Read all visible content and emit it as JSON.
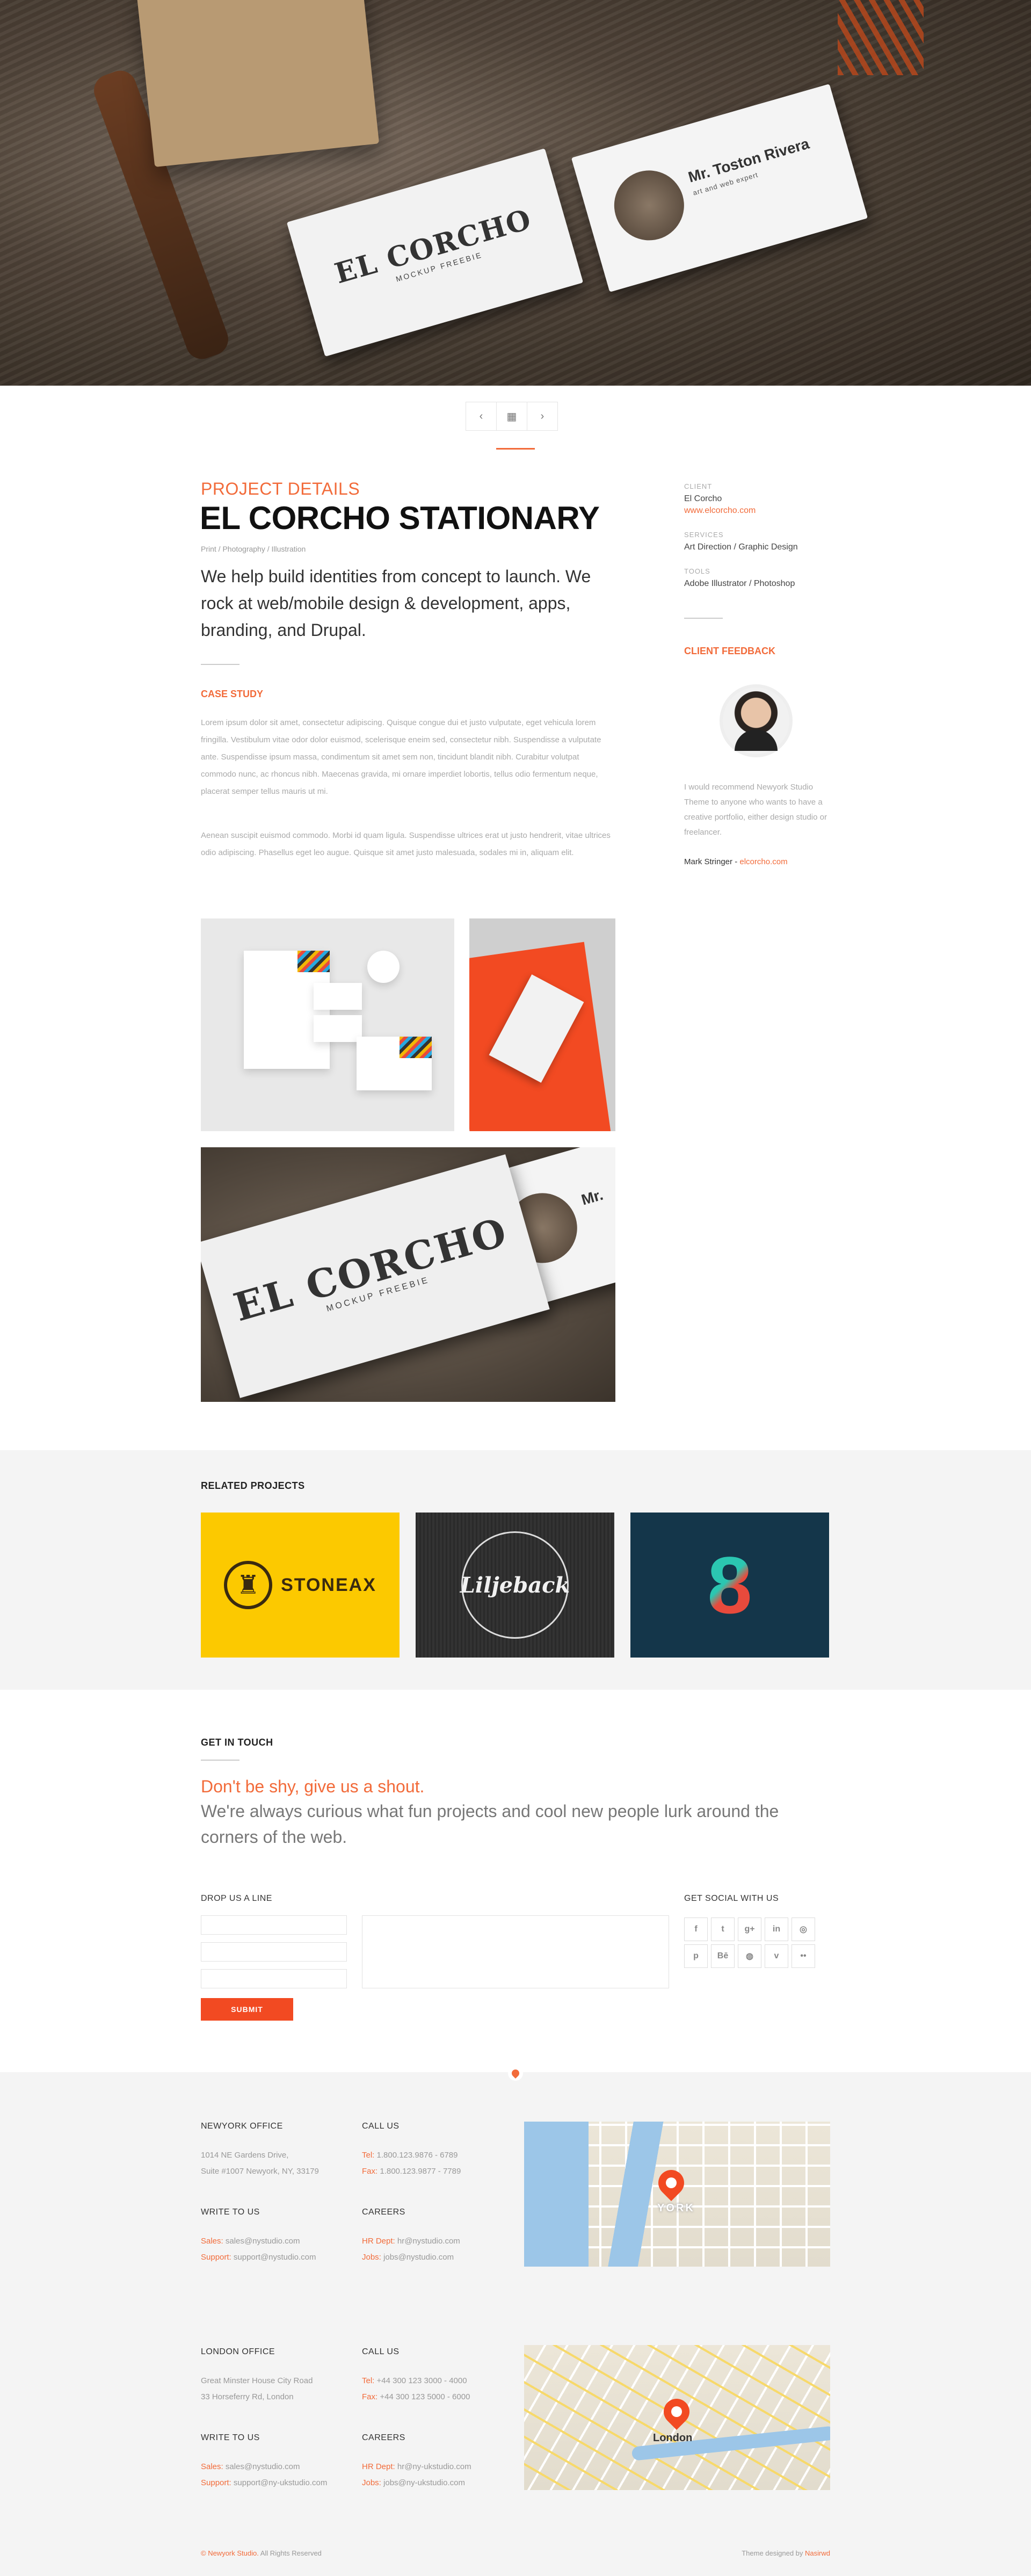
{
  "hero": {
    "card_logo": "EL CORCHO",
    "card_sub": "MOCKUP FREEBIE",
    "card2_name": "Mr. Toston Rivera",
    "card2_title": "art and web expert"
  },
  "postnav": {
    "prev_icon": "‹",
    "grid_icon": "▦",
    "next_icon": "›"
  },
  "project": {
    "kicker": "PROJECT DETAILS",
    "title": "EL CORCHO STATIONARY",
    "categories": "Print / Photography / Illustration",
    "lead": "We help build identities from concept to launch. We rock at web/mobile design & development, apps, branding, and Drupal.",
    "case_title": "CASE STUDY",
    "case_p1": "Lorem ipsum dolor sit amet, consectetur adipiscing. Quisque congue dui et justo vulputate, eget vehicula lorem fringilla. Vestibulum vitae odor dolor euismod, scelerisque eneim sed, consectetur nibh. Suspendisse a vulputate ante. Suspendisse ipsum massa, condimentum sit amet sem non, tincidunt blandit nibh. Curabitur volutpat commodo nunc, ac rhoncus nibh. Maecenas gravida, mi ornare imperdiet lobortis, tellus odio fermentum neque, placerat semper tellus mauris ut mi.",
    "case_p2": "Aenean suscipit euismod commodo. Morbi id quam ligula. Suspendisse ultrices erat ut justo hendrerit, vitae ultrices odio adipiscing. Phasellus eget leo augue. Quisque sit amet justo malesuada, sodales mi in, aliquam elit."
  },
  "meta": {
    "client_label": "CLIENT",
    "client_name": "El Corcho",
    "client_url": "www.elcorcho.com",
    "services_label": "SERVICES",
    "services": "Art Direction / Graphic Design",
    "tools_label": "TOOLS",
    "tools": "Adobe Illustrator / Photoshop"
  },
  "feedback": {
    "title": "CLIENT FEEDBACK",
    "quote": "I would recommend Newyork Studio Theme to anyone who wants to have a creative portfolio, either design studio or freelancer.",
    "author": "Mark Stringer",
    "author_site": "elcorcho.com"
  },
  "gallery": {
    "g3_logo": "EL CORCHO",
    "g3_sub": "MOCKUP FREEBIE",
    "g3_name": "Mr."
  },
  "related": {
    "title": "RELATED PROJECTS",
    "items": [
      {
        "label": "STONEAX"
      },
      {
        "label": "Liljeback"
      },
      {
        "label": "8"
      }
    ]
  },
  "contact": {
    "title": "GET IN TOUCH",
    "tagline": "Don't be shy, give us a shout.",
    "lead": "We're always curious what fun projects and cool new people lurk around the corners of the web.",
    "form_title": "DROP US A LINE",
    "submit": "SUBMIT",
    "social_title": "GET SOCIAL WITH US",
    "social": [
      {
        "icon": "facebook-icon",
        "glyph": "f"
      },
      {
        "icon": "twitter-icon",
        "glyph": "t"
      },
      {
        "icon": "googleplus-icon",
        "glyph": "g+"
      },
      {
        "icon": "linkedin-icon",
        "glyph": "in"
      },
      {
        "icon": "instagram-icon",
        "glyph": "◎"
      },
      {
        "icon": "pinterest-icon",
        "glyph": "p"
      },
      {
        "icon": "behance-icon",
        "glyph": "Bē"
      },
      {
        "icon": "dribbble-icon",
        "glyph": "◍"
      },
      {
        "icon": "vimeo-icon",
        "glyph": "v"
      },
      {
        "icon": "flickr-icon",
        "glyph": "••"
      }
    ]
  },
  "offices": {
    "ny": {
      "title": "NEWYORK OFFICE",
      "addr1": "1014 NE Gardens Drive,",
      "addr2": "Suite #1007 Newyork, NY, 33179",
      "call_title": "CALL US",
      "tel_k": "Tel:",
      "tel": "1.800.123.9876 - 6789",
      "fax_k": "Fax:",
      "fax": "1.800.123.9877 - 7789",
      "write_title": "WRITE TO US",
      "sales_k": "Sales:",
      "sales": "sales@nystudio.com",
      "support_k": "Support:",
      "support": "support@nystudio.com",
      "careers_title": "CAREERS",
      "hr_k": "HR Dept:",
      "hr": "hr@nystudio.com",
      "jobs_k": "Jobs:",
      "jobs": "jobs@nystudio.com"
    },
    "london": {
      "title": "LONDON OFFICE",
      "addr1": "Great Minster House City Road",
      "addr2": "33 Horseferry Rd, London",
      "call_title": "CALL US",
      "tel_k": "Tel:",
      "tel": "+44 300 123 3000 - 4000",
      "fax_k": "Fax:",
      "fax": "+44 300 123 5000 - 6000",
      "write_title": "WRITE TO US",
      "sales_k": "Sales:",
      "sales": "sales@nystudio.com",
      "support_k": "Support:",
      "support": "support@ny-ukstudio.com",
      "careers_title": "CAREERS",
      "hr_k": "HR Dept:",
      "hr": "hr@ny-ukstudio.com",
      "jobs_k": "Jobs:",
      "jobs": "jobs@ny-ukstudio.com"
    }
  },
  "maps": {
    "ny_label": "YORK",
    "london_label": "London"
  },
  "footer": {
    "copy_k": "© Newyork Studio.",
    "copy": "All Rights Reserved",
    "credit": "Theme designed by",
    "credit_k": "Nasirwd"
  },
  "colors": {
    "accent": "#f26b3a",
    "submit": "#f24a22",
    "footer_bg": "#f4f4f4"
  }
}
